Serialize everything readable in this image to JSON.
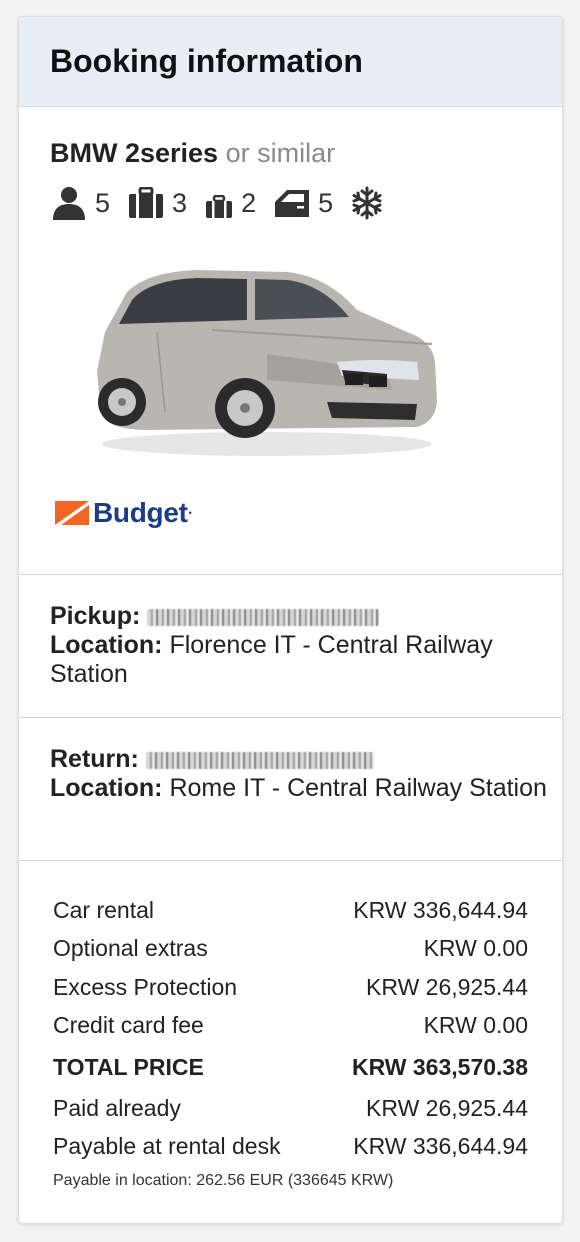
{
  "header": {
    "title": "Booking information"
  },
  "car": {
    "model": "BMW 2series",
    "similar_text": "or similar",
    "features": [
      {
        "icon": "passenger-icon",
        "value": "5"
      },
      {
        "icon": "large-bag-icon",
        "value": "3"
      },
      {
        "icon": "small-bag-icon",
        "value": "2"
      },
      {
        "icon": "doors-icon",
        "value": "5"
      },
      {
        "icon": "air-conditioning-icon",
        "value": ""
      }
    ],
    "image": "silver-bmw-2-series-car-image"
  },
  "supplier": {
    "name": "Budget",
    "logo_icon": "budget-logo"
  },
  "pickup": {
    "label": "Pickup:",
    "datetime": "",
    "location_label": "Location:",
    "location": "Florence IT - Central Railway Station"
  },
  "return": {
    "label": "Return:",
    "datetime": "",
    "location_label": "Location:",
    "location": "Rome IT - Central Railway Station"
  },
  "price_rows": [
    {
      "label": "Car rental",
      "amount": "KRW 336,644.94"
    },
    {
      "label": "Optional extras",
      "amount": "KRW 0.00"
    },
    {
      "label": "Excess Protection",
      "amount": "KRW 26,925.44"
    },
    {
      "label": "Credit card fee",
      "amount": "KRW 0.00"
    },
    {
      "label": "TOTAL PRICE",
      "amount": "KRW 363,570.38"
    },
    {
      "label": "Paid already",
      "amount": "KRW 26,925.44"
    },
    {
      "label": "Payable at rental desk",
      "amount": "KRW 336,644.94"
    }
  ],
  "note": "Payable in location: 262.56 EUR (336645 KRW)",
  "colors": {
    "header_bg": "#e8eef5",
    "brand_blue": "#1c3c88",
    "brand_orange": "#f26522",
    "car_silver": "#b9b6b0"
  }
}
